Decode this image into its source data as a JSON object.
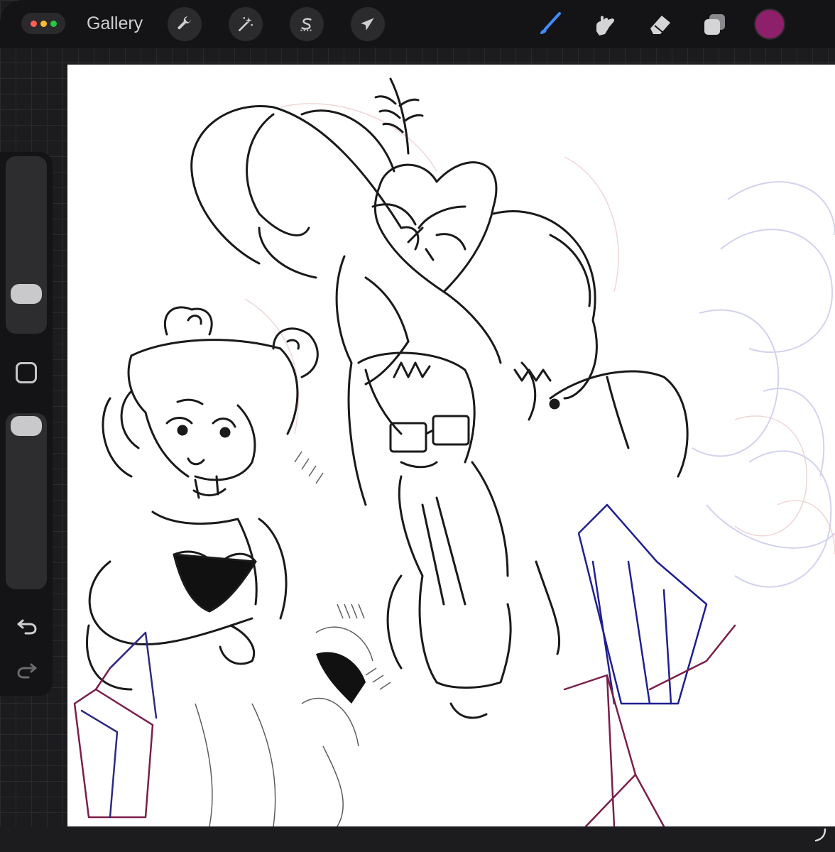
{
  "topbar": {
    "gallery_label": "Gallery",
    "window_dots": [
      "#ff5f57",
      "#febc2e",
      "#28c840"
    ],
    "left_tools": [
      "wrench-icon",
      "magic-wand-icon",
      "selection-s-icon",
      "transform-arrow-icon"
    ],
    "right_tools": [
      "brush-icon",
      "smudge-icon",
      "eraser-icon",
      "layers-icon"
    ],
    "active_tool": "brush-icon",
    "active_color": "#8e1f6a"
  },
  "sidebar": {
    "brush_size_level": 0.8,
    "opacity_level": 0.05,
    "modify_button": "square-icon",
    "undo_icon": "undo-icon",
    "redo_icon": "redo-icon"
  },
  "canvas": {
    "background": "#ffffff"
  }
}
